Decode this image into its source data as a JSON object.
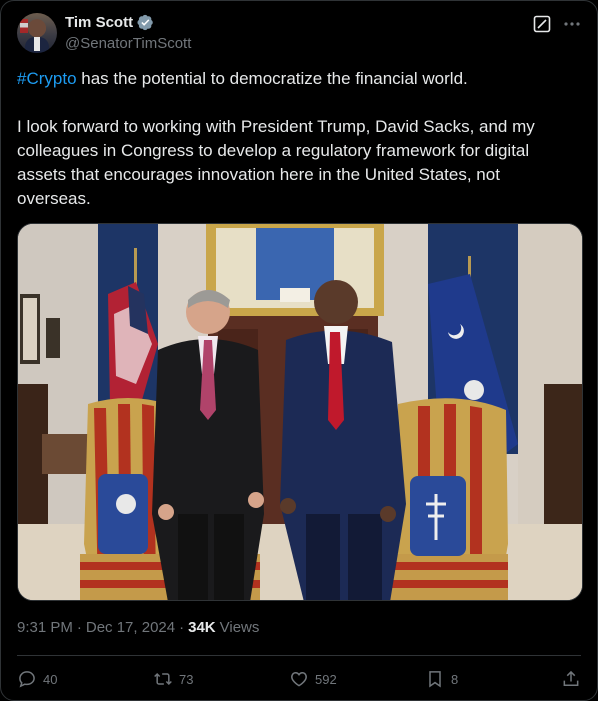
{
  "author": {
    "name": "Tim Scott",
    "handle": "@SenatorTimScott"
  },
  "tweet": {
    "hashtag": "#Crypto",
    "line1_rest": " has the potential to democratize the financial world.",
    "paragraph2": "I look forward to working with President Trump, David Sacks, and my colleagues in Congress to develop a regulatory framework for digital assets that encourages innovation here in the United States, not overseas."
  },
  "meta": {
    "time": "9:31 PM",
    "separator": "·",
    "date": "Dec 17, 2024",
    "separator2": "·",
    "views_count": "34K",
    "views_label": "Views"
  },
  "actions": {
    "replies": "40",
    "reposts": "73",
    "likes": "592",
    "bookmarks": "8"
  },
  "icons": [
    "verified-badge-icon",
    "grok-edit-icon",
    "more-icon",
    "reply-icon",
    "repost-icon",
    "like-icon",
    "bookmark-icon",
    "share-icon"
  ],
  "colors": {
    "accent": "#1d9bf0",
    "text": "#e7e9ea",
    "muted": "#71767b",
    "border": "#2f3336",
    "background": "#000000"
  }
}
